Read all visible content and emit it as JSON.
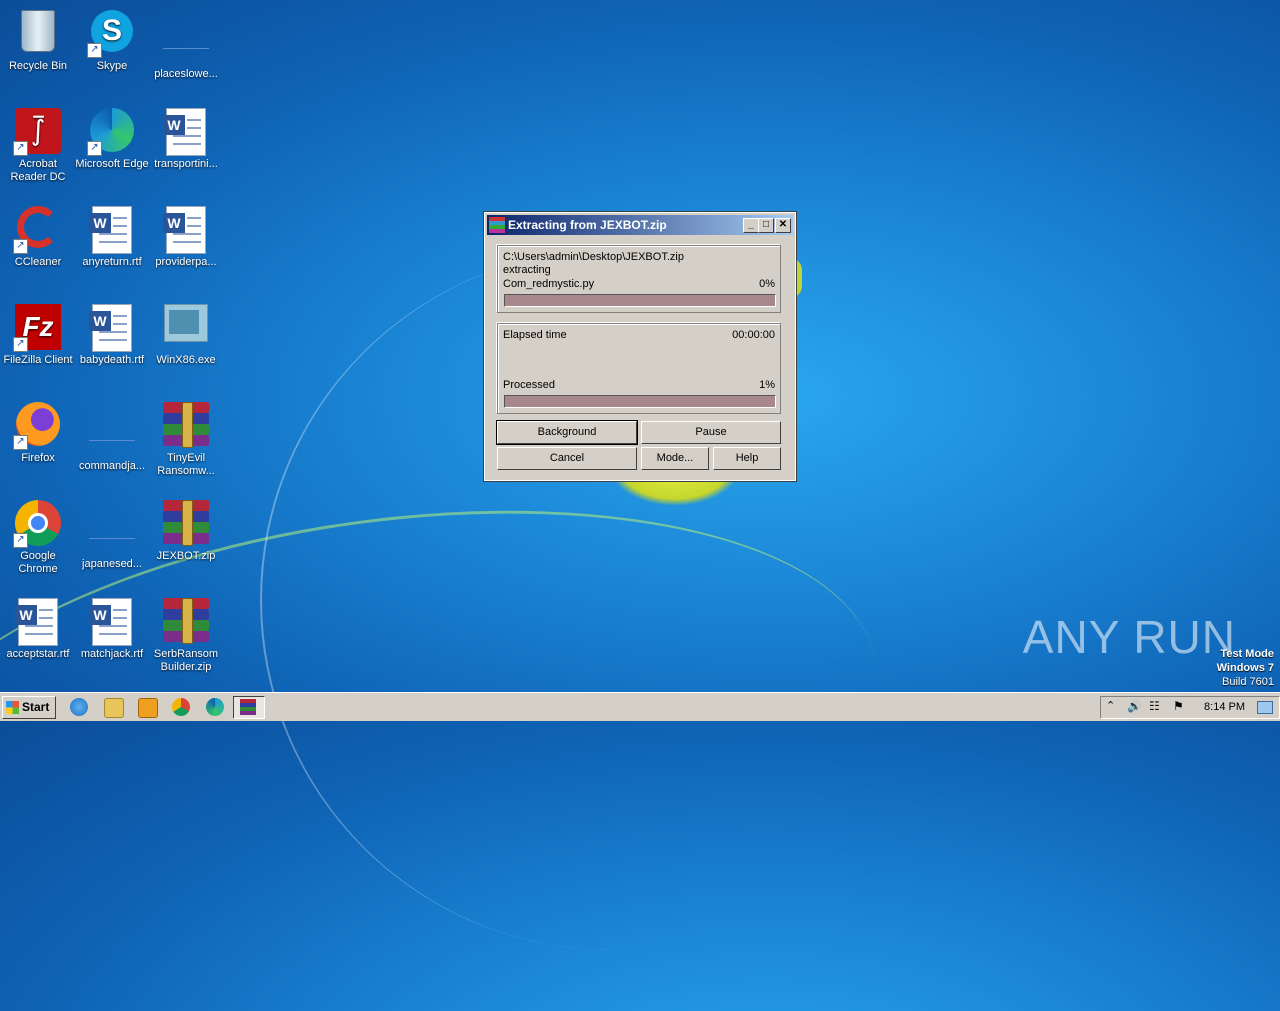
{
  "desktop": {
    "icons": [
      {
        "label": "Recycle Bin"
      },
      {
        "label": "Skype"
      },
      {
        "label": "placeslowe..."
      },
      {
        "label": "Acrobat Reader DC"
      },
      {
        "label": "Microsoft Edge"
      },
      {
        "label": "transportini..."
      },
      {
        "label": "CCleaner"
      },
      {
        "label": "anyreturn.rtf"
      },
      {
        "label": "providerpa..."
      },
      {
        "label": "FileZilla Client"
      },
      {
        "label": "babydeath.rtf"
      },
      {
        "label": "WinX86.exe"
      },
      {
        "label": "Firefox"
      },
      {
        "label": "commandja..."
      },
      {
        "label": "TinyEvil Ransomw..."
      },
      {
        "label": "Google Chrome"
      },
      {
        "label": "japanesed..."
      },
      {
        "label": "JEXBOT.zip"
      },
      {
        "label": "acceptstar.rtf"
      },
      {
        "label": "matchjack.rtf"
      },
      {
        "label": "SerbRansom Builder.zip"
      }
    ]
  },
  "dialog": {
    "title": "Extracting from JEXBOT.zip",
    "archive_path": "C:\\Users\\admin\\Desktop\\JEXBOT.zip",
    "action": "extracting",
    "current_file": "Com_redmystic.py",
    "file_percent": "0%",
    "file_progress": 0.0,
    "elapsed_label": "Elapsed time",
    "elapsed_value": "00:00:00",
    "processed_label": "Processed",
    "processed_percent": "1%",
    "processed_progress": 0.01,
    "buttons": {
      "background": "Background",
      "pause": "Pause",
      "cancel": "Cancel",
      "mode": "Mode...",
      "help": "Help"
    }
  },
  "taskbar": {
    "start_label": "Start",
    "clock": "8:14 PM"
  },
  "watermark": {
    "brand": "ANY RUN",
    "test_mode": "Test Mode",
    "os": "Windows 7",
    "build": "Build 7601"
  },
  "colors": {
    "desktop": "#1b86d6",
    "progress_fill": "#a8888c",
    "title_active": "#0a246a"
  }
}
